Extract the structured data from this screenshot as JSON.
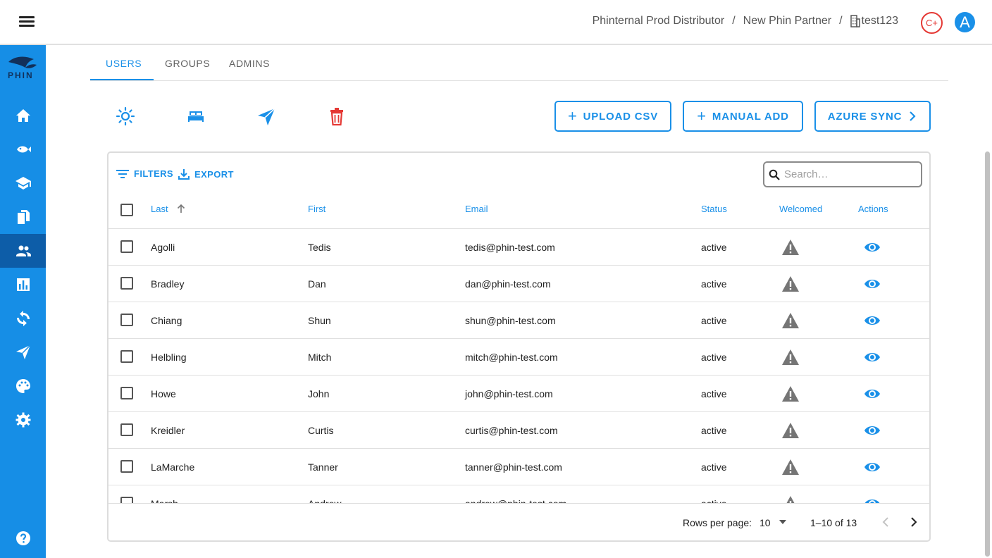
{
  "breadcrumb": {
    "items": [
      "Phinternal Prod Distributor",
      "New Phin Partner",
      "test123"
    ],
    "separator": "/"
  },
  "header": {
    "badge_label": "C+",
    "avatar_letter": "A"
  },
  "sidebar": {
    "logo_text": "PHIN",
    "items": [
      {
        "icon": "home-icon"
      },
      {
        "icon": "phish-icon"
      },
      {
        "icon": "school-icon"
      },
      {
        "icon": "documents-icon"
      },
      {
        "icon": "users-icon",
        "active": true
      },
      {
        "icon": "bar-chart-icon"
      },
      {
        "icon": "sync-icon"
      },
      {
        "icon": "send-icon"
      },
      {
        "icon": "palette-icon"
      },
      {
        "icon": "settings-icon"
      },
      {
        "icon": "help-icon"
      }
    ]
  },
  "tabs": [
    {
      "label": "USERS",
      "active": true
    },
    {
      "label": "GROUPS"
    },
    {
      "label": "ADMINS"
    }
  ],
  "toolbar": {
    "upload_csv": "UPLOAD CSV",
    "manual_add": "MANUAL ADD",
    "azure_sync": "AZURE SYNC"
  },
  "table": {
    "filters_label": "FILTERS",
    "export_label": "EXPORT",
    "search_placeholder": "Search…",
    "columns": [
      "Last",
      "First",
      "Email",
      "Status",
      "Welcomed",
      "Actions"
    ],
    "sort_column": "Last",
    "sort_direction": "ascending",
    "rows": [
      {
        "last": "Agolli",
        "first": "Tedis",
        "email": "tedis@phin-test.com",
        "status": "active"
      },
      {
        "last": "Bradley",
        "first": "Dan",
        "email": "dan@phin-test.com",
        "status": "active"
      },
      {
        "last": "Chiang",
        "first": "Shun",
        "email": "shun@phin-test.com",
        "status": "active"
      },
      {
        "last": "Helbling",
        "first": "Mitch",
        "email": "mitch@phin-test.com",
        "status": "active"
      },
      {
        "last": "Howe",
        "first": "John",
        "email": "john@phin-test.com",
        "status": "active"
      },
      {
        "last": "Kreidler",
        "first": "Curtis",
        "email": "curtis@phin-test.com",
        "status": "active"
      },
      {
        "last": "LaMarche",
        "first": "Tanner",
        "email": "tanner@phin-test.com",
        "status": "active"
      },
      {
        "last": "Marsh",
        "first": "Andrew",
        "email": "andrew@phin-test.com",
        "status": "active"
      }
    ],
    "rows_per_page_label": "Rows per page:",
    "rows_per_page": "10",
    "range_label": "1–10 of 13"
  },
  "colors": {
    "accent": "#1a90e8",
    "sidebar": "#168ee6",
    "sidebar_active": "#0d5da8",
    "danger": "#e53935",
    "warning_icon": "#757575"
  }
}
